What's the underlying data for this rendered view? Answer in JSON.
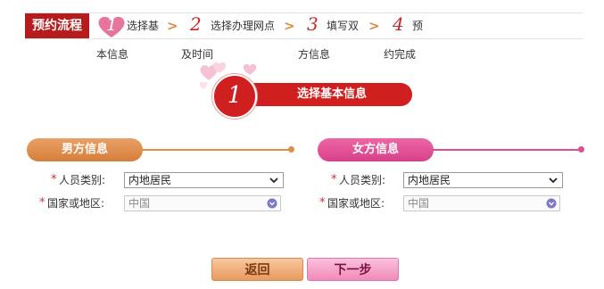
{
  "flow": {
    "title": "预约流程",
    "steps": [
      {
        "num": "1",
        "label_a": "选择基",
        "label_b": "本信息"
      },
      {
        "num": "2",
        "label_a": "选择办理网点",
        "label_b": "及时间"
      },
      {
        "num": "3",
        "label_a": "填写双",
        "label_b": "方信息"
      },
      {
        "num": "4",
        "label_a": "预",
        "label_b": "约完成"
      }
    ],
    "arrow": ">"
  },
  "banner": {
    "num": "1",
    "title": "选择基本信息"
  },
  "male": {
    "header": "男方信息",
    "person_type_label": "人员类别:",
    "person_type_value": "内地居民",
    "region_label": "国家或地区:",
    "region_value": "中国"
  },
  "female": {
    "header": "女方信息",
    "person_type_label": "人员类别:",
    "person_type_value": "内地居民",
    "region_label": "国家或地区:",
    "region_value": "中国"
  },
  "required_mark": "*",
  "buttons": {
    "back": "返回",
    "next": "下一步"
  },
  "colors": {
    "flow_title_bg": "#b71c1c",
    "step_accent": "#c62828",
    "banner": "#cf1f1f",
    "male_accent": "#df8e4a",
    "female_accent": "#dc4e91"
  }
}
